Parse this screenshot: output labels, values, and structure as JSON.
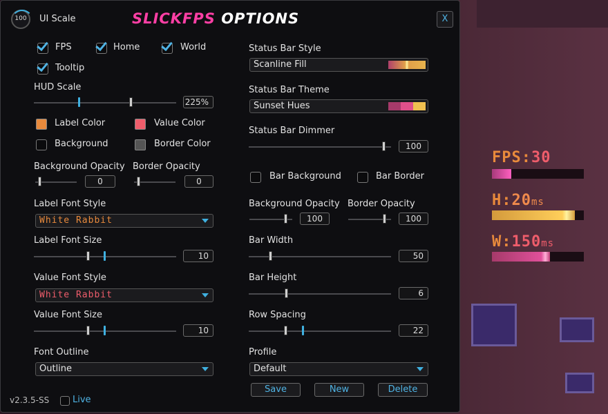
{
  "header": {
    "ui_scale_value": "100",
    "ui_scale_label": "UI Scale",
    "title_part1": "SLICK",
    "title_part2": "FPS",
    "title_part3": "OPTIONS",
    "close_label": "X"
  },
  "checks": {
    "fps": "FPS",
    "home": "Home",
    "world": "World",
    "tooltip": "Tooltip"
  },
  "left": {
    "hud_scale_label": "HUD Scale",
    "hud_scale_value": "225%",
    "label_color": "Label Color",
    "value_color": "Value Color",
    "background": "Background",
    "border_color": "Border Color",
    "bg_opacity_label": "Background Opacity",
    "border_opacity_label": "Border Opacity",
    "bg_opacity_value": "0",
    "border_opacity_value": "0",
    "label_font_style_label": "Label Font Style",
    "label_font_style_value": "White Rabbit",
    "label_font_size_label": "Label Font Size",
    "label_font_size_value": "10",
    "value_font_style_label": "Value Font Style",
    "value_font_style_value": "White Rabbit",
    "value_font_size_label": "Value Font Size",
    "value_font_size_value": "10",
    "font_outline_label": "Font Outline",
    "font_outline_value": "Outline"
  },
  "right": {
    "status_bar_style_label": "Status Bar Style",
    "status_bar_style_value": "Scanline Fill",
    "status_bar_theme_label": "Status Bar Theme",
    "status_bar_theme_value": "Sunset Hues",
    "status_bar_dimmer_label": "Status Bar Dimmer",
    "status_bar_dimmer_value": "100",
    "bar_background": "Bar Background",
    "bar_border": "Bar Border",
    "bg_opacity_label": "Background Opacity",
    "border_opacity_label": "Border Opacity",
    "bg_opacity_value": "100",
    "border_opacity_value": "100",
    "bar_width_label": "Bar Width",
    "bar_width_value": "50",
    "bar_height_label": "Bar Height",
    "bar_height_value": "6",
    "row_spacing_label": "Row Spacing",
    "row_spacing_value": "22",
    "profile_label": "Profile",
    "profile_value": "Default",
    "save": "Save",
    "new": "New",
    "delete": "Delete"
  },
  "footer": {
    "version": "v2.3.5-SS",
    "live": "Live"
  },
  "hud": {
    "fps_label": "FPS:",
    "fps_value": "30",
    "home_label": "H:",
    "home_value": "20",
    "home_unit": "ms",
    "world_label": "W:",
    "world_value": "150",
    "world_unit": "ms"
  },
  "colors": {
    "accent": "#4fb3e4",
    "label_color": "#e98a3c",
    "value_color": "#ef5d6b",
    "border_color": "#555555",
    "pink": "#ff3fa5"
  }
}
